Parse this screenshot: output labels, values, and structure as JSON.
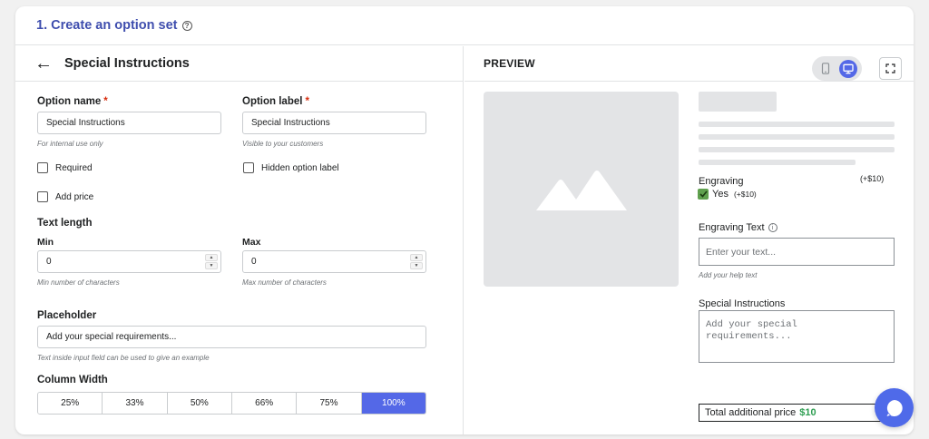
{
  "header": {
    "step_title": "1. Create an option set"
  },
  "editor": {
    "title": "Special Instructions",
    "option_name": {
      "label": "Option name",
      "required_mark": "*",
      "value": "Special Instructions",
      "hint": "For internal use only"
    },
    "option_label": {
      "label": "Option label",
      "required_mark": "*",
      "value": "Special Instructions",
      "hint": "Visible to your customers"
    },
    "required_label": "Required",
    "hidden_label": "Hidden option label",
    "add_price_label": "Add price",
    "text_length": {
      "title": "Text length",
      "min": {
        "label": "Min",
        "value": "0",
        "hint": "Min number of characters"
      },
      "max": {
        "label": "Max",
        "value": "0",
        "hint": "Max number of characters"
      }
    },
    "placeholder": {
      "label": "Placeholder",
      "value": "Add your special requirements...",
      "hint": "Text inside input field can be used to give an example"
    },
    "column_width": {
      "label": "Column Width",
      "options": [
        "25%",
        "33%",
        "50%",
        "66%",
        "75%",
        "100%"
      ],
      "selected": "100%"
    }
  },
  "preview": {
    "title": "PREVIEW",
    "engraving": {
      "label": "Engraving",
      "price": "(+$10)",
      "option_label": "Yes",
      "option_price": "(+$10)"
    },
    "engraving_text": {
      "label": "Engraving Text",
      "placeholder": "Enter your text...",
      "help": "Add your help text"
    },
    "special": {
      "label": "Special Instructions",
      "placeholder": "Add your special requirements..."
    },
    "total": {
      "label": "Total additional price",
      "amount": "$10"
    }
  },
  "colors": {
    "accent": "#5468e7",
    "title": "#3f4eae",
    "price": "#2e9e52"
  }
}
